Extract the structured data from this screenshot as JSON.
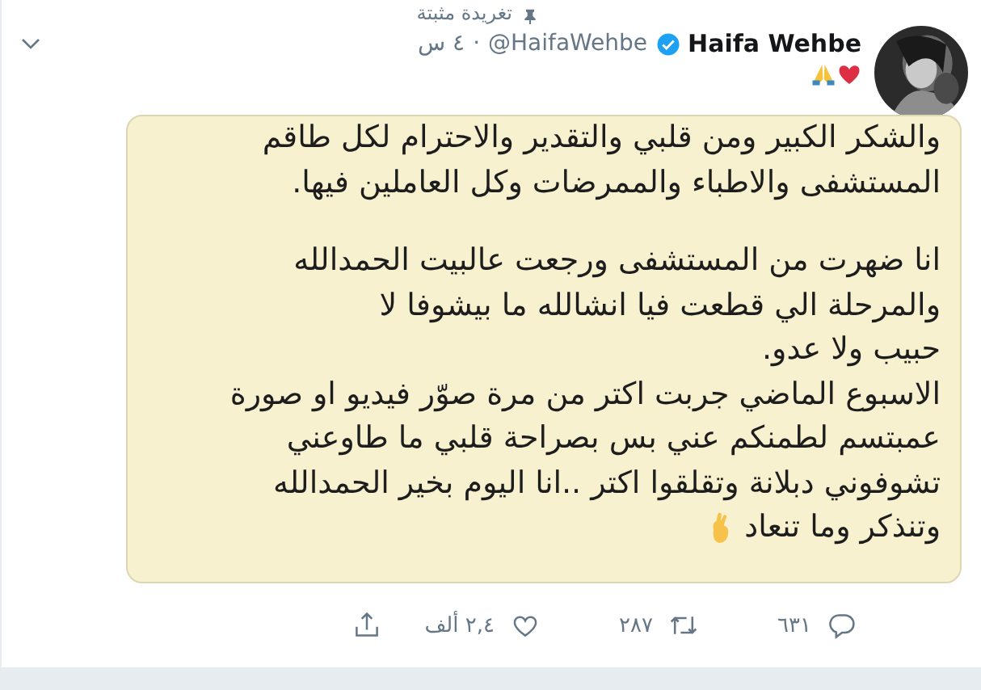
{
  "pinned_label": "تغريدة مثبتة",
  "author": {
    "name": "Haifa Wehbe",
    "verified": true,
    "handle": "@HaifaWehbe",
    "separator": "·",
    "time": "٤ س"
  },
  "image_text": {
    "paragraphs": [
      [
        "والشكر الكبير  ومن قلبي والتقدير والاحترام لكل طاقم",
        "المستشفى والاطباء  والممرضات وكل العاملين فيها."
      ],
      [
        "انا ضهرت من المستشفى ورجعت عالبيت الحمدالله",
        "والمرحلة الي قطعت فيا انشالله ما بيشوفا لا",
        "حبيب ولا عدو.",
        "الاسبوع الماضي جربت اكتر من مرة صوّر فيديو او صورة",
        "عمبتسم لطمنكم عني بس بصراحة قلبي ما طاوعني",
        "تشوفوني دبلانة وتقلقوا اكتر ..انا اليوم بخير الحمدالله",
        "وتنذكر وما تنعاد"
      ]
    ]
  },
  "actions": [
    {
      "kind": "reply",
      "count": "٦٣١"
    },
    {
      "kind": "retweet",
      "count": "٢٨٧"
    },
    {
      "kind": "like",
      "count": "٢,٤ ألف"
    },
    {
      "kind": "share"
    }
  ]
}
